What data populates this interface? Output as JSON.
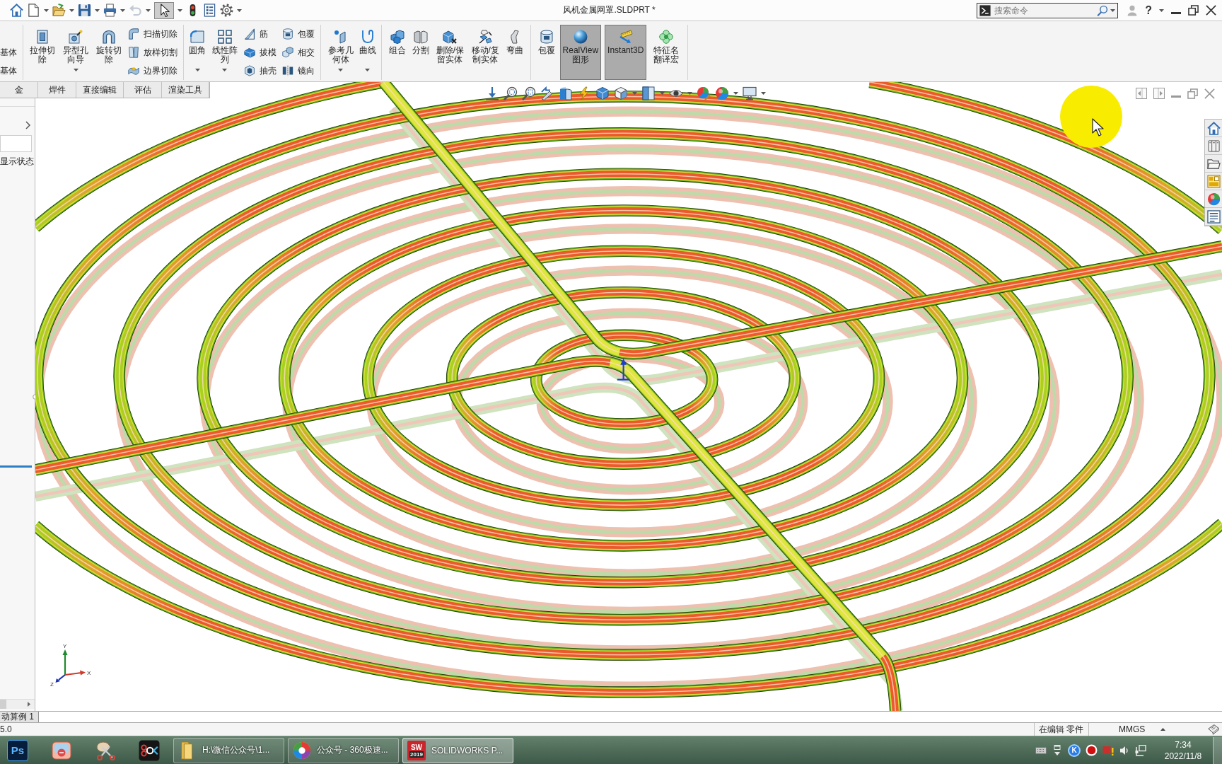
{
  "title_bar": {
    "quick_access": {
      "undo_disabled": true,
      "select_pressed": true
    },
    "title": "风机金属网罩.SLDPRT *",
    "search": {
      "placeholder": "搜索命令"
    },
    "help_label": "?"
  },
  "ribbon": {
    "groups": [
      {
        "items": [
          {
            "kind": "column",
            "entries": [
              "基体",
              "基体"
            ]
          }
        ]
      },
      {
        "items": [
          {
            "kind": "big",
            "label": "拉伸切除",
            "dropdown": false,
            "pressed": false
          },
          {
            "kind": "big",
            "label": "异型孔向导",
            "dropdown": true,
            "pressed": false
          },
          {
            "kind": "big",
            "label": "旋转切除",
            "dropdown": false,
            "pressed": false
          },
          {
            "kind": "column",
            "entries": [
              "扫描切除",
              "放样切割",
              "边界切除"
            ]
          }
        ]
      },
      {
        "items": [
          {
            "kind": "big",
            "label": "圆角",
            "dropdown": true,
            "pressed": false
          },
          {
            "kind": "big",
            "label": "线性阵列",
            "dropdown": true,
            "pressed": false
          },
          {
            "kind": "column",
            "entries": [
              "筋",
              "拔模",
              "抽壳"
            ]
          },
          {
            "kind": "column",
            "entries": [
              "包覆",
              "相交",
              "镜向"
            ]
          }
        ]
      },
      {
        "items": [
          {
            "kind": "big",
            "label": "参考几何体",
            "dropdown": true,
            "pressed": false
          },
          {
            "kind": "big",
            "label": "曲线",
            "dropdown": true,
            "pressed": false
          }
        ]
      },
      {
        "items": [
          {
            "kind": "big",
            "label": "组合",
            "dropdown": false,
            "pressed": false
          },
          {
            "kind": "big",
            "label": "分割",
            "dropdown": false,
            "pressed": false
          },
          {
            "kind": "big",
            "label": "删除/保留实体",
            "dropdown": false,
            "pressed": false
          },
          {
            "kind": "big",
            "label": "移动/复制实体",
            "dropdown": false,
            "pressed": false
          },
          {
            "kind": "big",
            "label": "弯曲",
            "dropdown": false,
            "pressed": false
          }
        ]
      },
      {
        "items": [
          {
            "kind": "big",
            "label": "包覆",
            "dropdown": false,
            "pressed": false
          },
          {
            "kind": "big",
            "label": "RealView图形",
            "dropdown": false,
            "pressed": true
          },
          {
            "kind": "big",
            "label": "Instant3D",
            "dropdown": false,
            "pressed": true
          },
          {
            "kind": "big",
            "label": "特征名翻译宏",
            "dropdown": false,
            "pressed": false
          }
        ]
      }
    ]
  },
  "command_tabs": [
    {
      "label": "金",
      "selected": false
    },
    {
      "label": "焊件",
      "selected": false
    },
    {
      "label": "直接编辑",
      "selected": false
    },
    {
      "label": "评估",
      "selected": false
    },
    {
      "label": "渲染工具",
      "selected": false
    }
  ],
  "feature_tree": {
    "display_state": "显示状态"
  },
  "viewport": {
    "axis_labels": {
      "x": "X",
      "y": "Y",
      "z": "Z"
    }
  },
  "motion_study_tabs": [
    {
      "label": "动算例 1",
      "selected": true
    }
  ],
  "status_bar": {
    "message": "5.0",
    "mode": "在编辑 零件",
    "units": "MMGS"
  },
  "taskbar": {
    "pinned": [
      {
        "kind": "tile",
        "label": "Ps"
      },
      {
        "kind": "photo-album"
      },
      {
        "kind": "scissors"
      },
      {
        "kind": "recorder"
      }
    ],
    "windows": [
      {
        "kind": "folder",
        "label": "H:\\微信公众号\\1...",
        "selected": false
      },
      {
        "kind": "color-ring",
        "label": "公众号 - 360极速...",
        "selected": false
      },
      {
        "kind": "app-logo",
        "logo": "SW",
        "badge": "2019",
        "label": "SOLIDWORKS P...",
        "selected": true
      }
    ],
    "tray": [
      {
        "kind": "keyboard"
      },
      {
        "kind": "window-caret"
      },
      {
        "kind": "letter-badge",
        "label": "K"
      },
      {
        "kind": "record"
      },
      {
        "kind": "warning-cube"
      },
      {
        "kind": "speaker"
      },
      {
        "kind": "network"
      }
    ],
    "clock": {
      "time": "7:34",
      "date": "2022/11/8"
    }
  }
}
